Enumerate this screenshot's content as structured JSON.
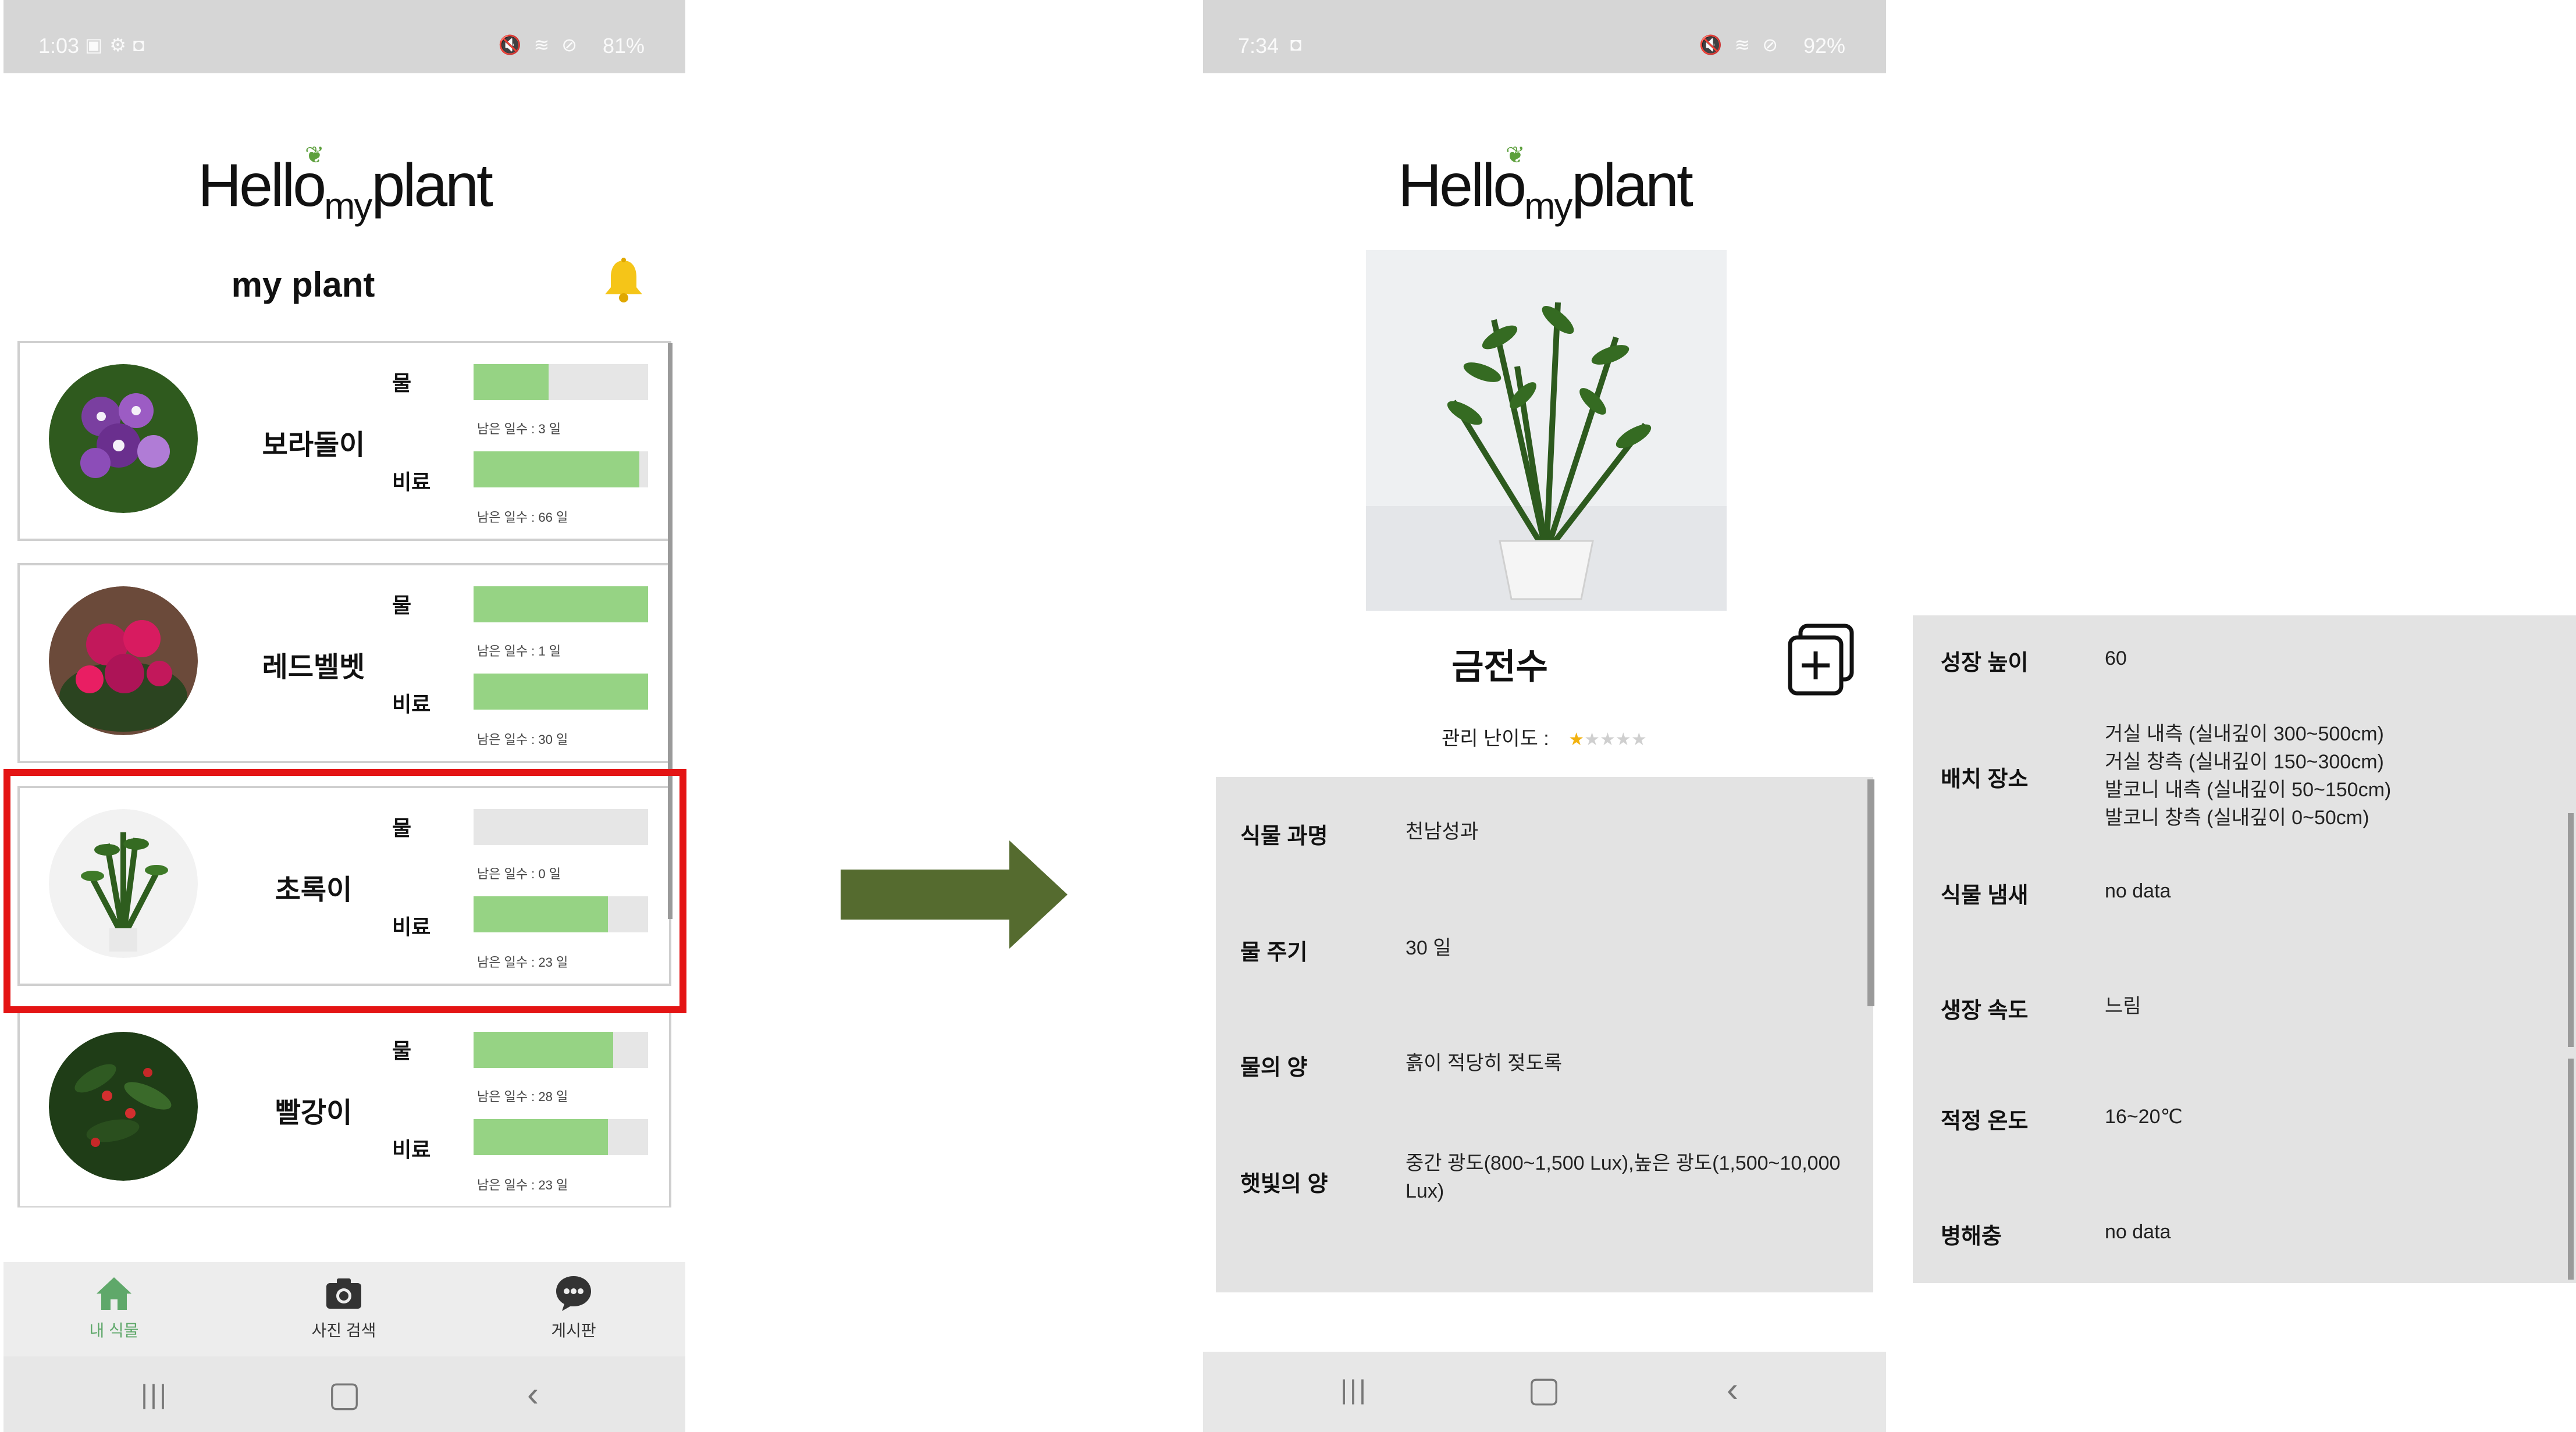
{
  "left": {
    "status": {
      "time": "1:03",
      "battery": "81%"
    },
    "logo": {
      "hello": "Hello",
      "my": "my",
      "plant": "plant"
    },
    "title": "my plant",
    "plants": [
      {
        "name": "보라돌이",
        "water_label": "물",
        "fert_label": "비료",
        "water_days": "남은 일수 : 3 일",
        "fert_days": "남은 일수 : 66 일",
        "water_level": 0.43,
        "fert_level": 0.95
      },
      {
        "name": "레드벨벳",
        "water_label": "물",
        "fert_label": "비료",
        "water_days": "남은 일수 : 1 일",
        "fert_days": "남은 일수 : 30 일",
        "water_level": 1.0,
        "fert_level": 1.0
      },
      {
        "name": "초록이",
        "water_label": "물",
        "fert_label": "비료",
        "water_days": "남은 일수 : 0 일",
        "fert_days": "남은 일수 : 23 일",
        "water_level": 0.0,
        "fert_level": 0.77
      },
      {
        "name": "빨강이",
        "water_label": "물",
        "fert_label": "비료",
        "water_days": "남은 일수 : 28 일",
        "fert_days": "남은 일수 : 23 일",
        "water_level": 0.8,
        "fert_level": 0.77
      }
    ],
    "nav": [
      {
        "label": "내 식물",
        "icon": "home-icon",
        "color": "#5fa86a"
      },
      {
        "label": "사진 검색",
        "icon": "camera-icon",
        "color": "#333333"
      },
      {
        "label": "게시판",
        "icon": "chat-icon",
        "color": "#333333"
      }
    ]
  },
  "right": {
    "status": {
      "time": "7:34",
      "battery": "92%"
    },
    "logo": {
      "hello": "Hello",
      "my": "my",
      "plant": "plant"
    },
    "plant_name": "금전수",
    "difficulty_label": "관리 난이도 :",
    "difficulty_rating": 1,
    "difficulty_max": 5,
    "info": [
      {
        "key": "식물 과명",
        "value": "천남성과"
      },
      {
        "key": "물 주기",
        "value": "30 일"
      },
      {
        "key": "물의 양",
        "value": "흙이 적당히 젖도록"
      },
      {
        "key": "햇빛의 양",
        "value": "중간 광도(800~1,500 Lux),높은 광도(1,500~10,000 Lux)"
      }
    ]
  },
  "extended_info": [
    {
      "key": "성장 높이",
      "value": "60"
    },
    {
      "key": "배치 장소",
      "value": "거실 내측 (실내깊이 300~500cm)\n거실 창측 (실내깊이 150~300cm)\n발코니 내측 (실내깊이 50~150cm)\n발코니 창측 (실내깊이 0~50cm)"
    },
    {
      "key": "식물 냄새",
      "value": "no data"
    },
    {
      "key": "생장 속도",
      "value": "느림"
    },
    {
      "key": "적정 온도",
      "value": "16~20℃"
    },
    {
      "key": "병해충",
      "value": "no data"
    }
  ],
  "colors": {
    "bar_fill": "#96d384",
    "bar_track": "#e6e6e6",
    "highlight": "#e41414",
    "arrow": "#556b2f",
    "panel": "#e3e3e3"
  }
}
